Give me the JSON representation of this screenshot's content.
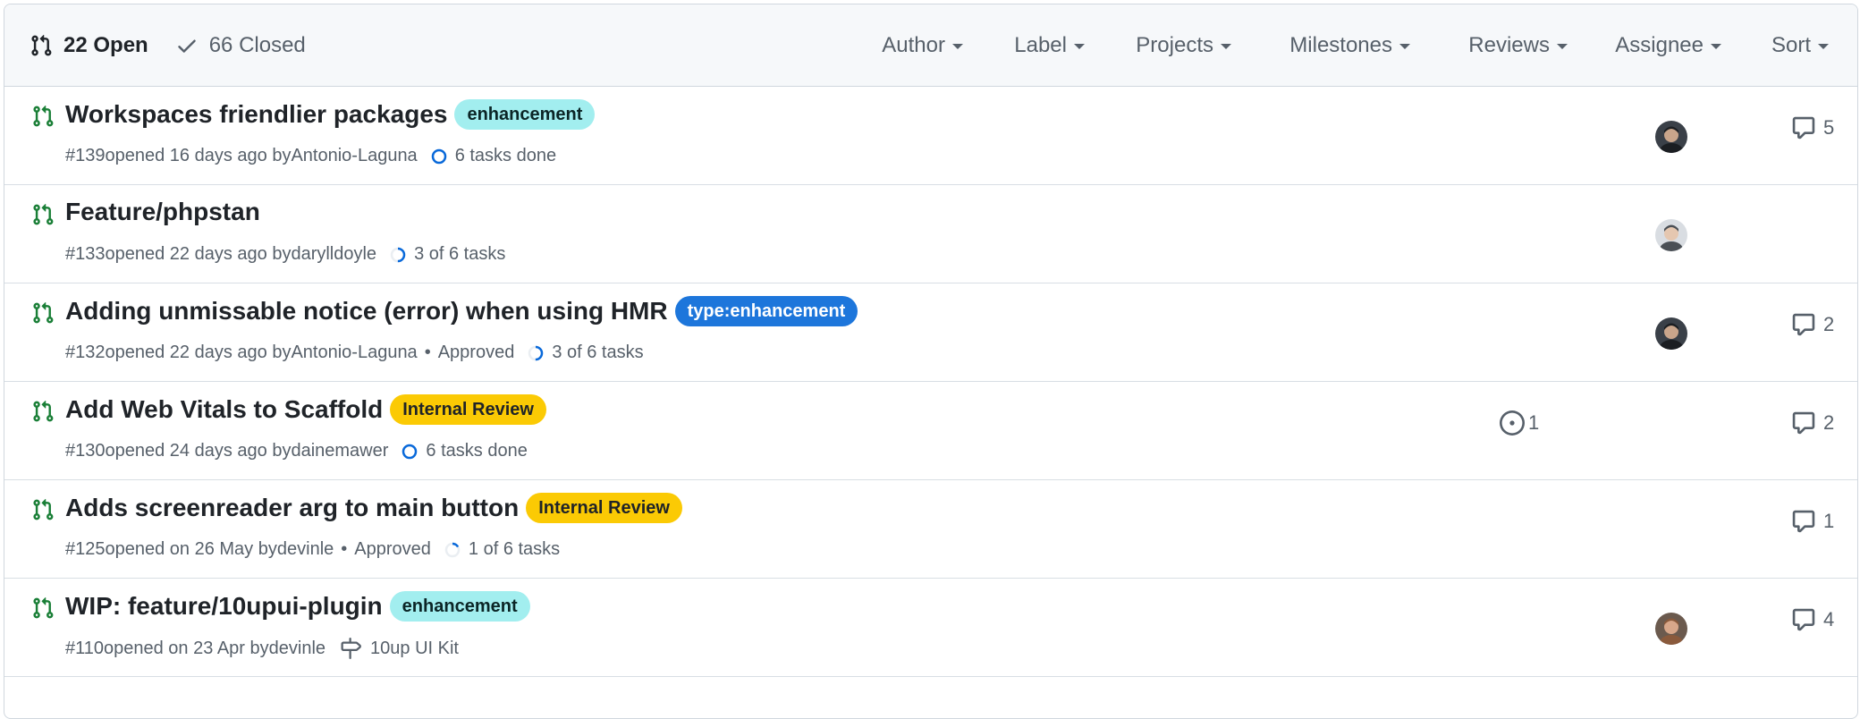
{
  "header": {
    "open_label": "22 Open",
    "closed_label": "66 Closed",
    "filters": [
      "Author",
      "Label",
      "Projects",
      "Milestones",
      "Reviews",
      "Assignee",
      "Sort"
    ]
  },
  "pulls": [
    {
      "title": "Workspaces friendlier packages",
      "label": {
        "text": "enhancement",
        "bg": "#a2eeef",
        "fg": "#0b2526"
      },
      "number": "#139",
      "opened": "opened 16 days ago by",
      "author": "Antonio-Laguna",
      "review": "",
      "tasks": "6 tasks done",
      "task_progress": 1.0,
      "milestone": "",
      "linked_issues": "",
      "avatar": "dark",
      "comments": "5"
    },
    {
      "title": "Feature/phpstan",
      "label": null,
      "number": "#133",
      "opened": "opened 22 days ago by",
      "author": "darylldoyle",
      "review": "",
      "tasks": "3 of 6 tasks",
      "task_progress": 0.5,
      "milestone": "",
      "linked_issues": "",
      "avatar": "light",
      "comments": ""
    },
    {
      "title": "Adding unmissable notice (error) when using HMR",
      "label": {
        "text": "type:enhancement",
        "bg": "#1d76db",
        "fg": "#ffffff"
      },
      "number": "#132",
      "opened": "opened 22 days ago by",
      "author": "Antonio-Laguna",
      "review": "Approved",
      "tasks": "3 of 6 tasks",
      "task_progress": 0.5,
      "milestone": "",
      "linked_issues": "",
      "avatar": "dark",
      "comments": "2"
    },
    {
      "title": "Add Web Vitals to Scaffold",
      "label": {
        "text": "Internal Review",
        "bg": "#fbca04",
        "fg": "#1f2328"
      },
      "number": "#130",
      "opened": "opened 24 days ago by",
      "author": "dainemawer",
      "review": "",
      "tasks": "6 tasks done",
      "task_progress": 1.0,
      "milestone": "",
      "linked_issues": "1",
      "avatar": "",
      "comments": "2"
    },
    {
      "title": "Adds screenreader arg to main button",
      "label": {
        "text": "Internal Review",
        "bg": "#fbca04",
        "fg": "#1f2328"
      },
      "number": "#125",
      "opened": "opened on 26 May by",
      "author": "devinle",
      "review": "Approved",
      "tasks": "1 of 6 tasks",
      "task_progress": 0.1667,
      "milestone": "",
      "linked_issues": "",
      "avatar": "",
      "comments": "1"
    },
    {
      "title": "WIP: feature/10upui-plugin",
      "label": {
        "text": "enhancement",
        "bg": "#a2eeef",
        "fg": "#0b2526"
      },
      "number": "#110",
      "opened": "opened on 23 Apr by",
      "author": "devinle",
      "review": "",
      "tasks": "",
      "task_progress": null,
      "milestone": "10up UI Kit",
      "linked_issues": "",
      "avatar": "brown",
      "comments": "4"
    }
  ],
  "colors": {
    "pr_open": "#1a7f37",
    "task_blue": "#0969da",
    "muted": "#57606a"
  }
}
